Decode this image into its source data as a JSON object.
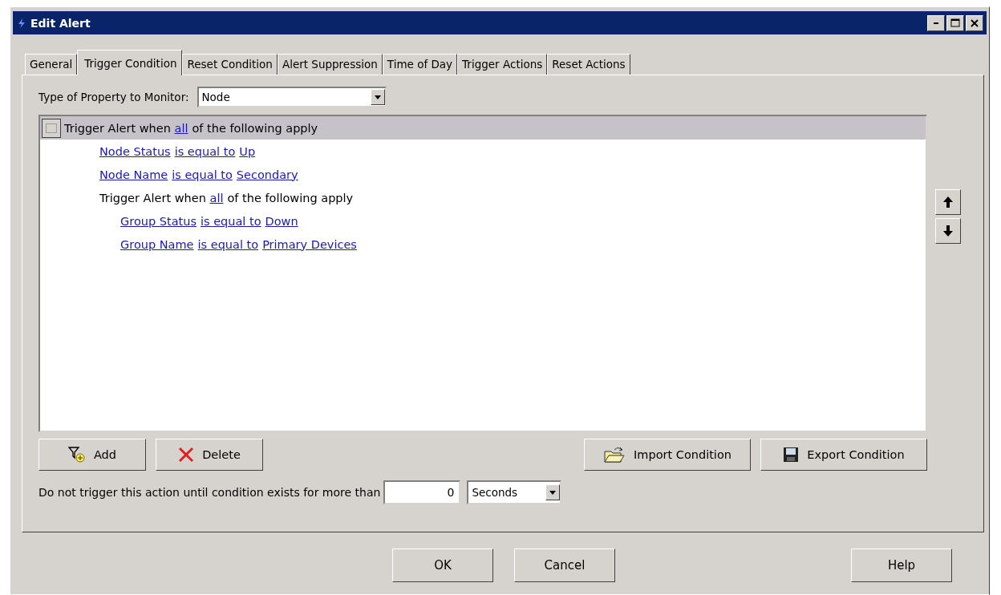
{
  "window": {
    "title": "Edit Alert"
  },
  "tabs": [
    {
      "label": "General",
      "selected": false
    },
    {
      "label": "Trigger Condition",
      "selected": true
    },
    {
      "label": "Reset Condition",
      "selected": false
    },
    {
      "label": "Alert Suppression",
      "selected": false
    },
    {
      "label": "Time of Day",
      "selected": false
    },
    {
      "label": "Trigger Actions",
      "selected": false
    },
    {
      "label": "Reset Actions",
      "selected": false
    }
  ],
  "property_type": {
    "label": "Type of Property to Monitor:",
    "value": "Node"
  },
  "condition_tree": [
    {
      "kind": "group",
      "prefix": "Trigger Alert when",
      "quantifier": "all",
      "suffix": "of the following apply",
      "selected": true,
      "children": [
        {
          "kind": "condition",
          "field": "Node Status",
          "operator": "is equal to",
          "value": "Up",
          "selected": false
        },
        {
          "kind": "condition",
          "field": "Node Name",
          "operator": "is equal to",
          "value": "Secondary",
          "selected": false
        },
        {
          "kind": "group",
          "prefix": "Trigger Alert when",
          "quantifier": "all",
          "suffix": "of the following apply",
          "selected": false,
          "children": [
            {
              "kind": "condition",
              "field": "Group Status",
              "operator": "is equal to",
              "value": "Down",
              "selected": false
            },
            {
              "kind": "condition",
              "field": "Group Name",
              "operator": "is equal to",
              "value": "Primary Devices",
              "selected": false
            }
          ]
        }
      ]
    }
  ],
  "condition_buttons": [
    {
      "kind": "add",
      "label": "Add"
    },
    {
      "kind": "delete",
      "label": "Delete"
    },
    {
      "kind": "import",
      "label": "Import Condition"
    },
    {
      "kind": "export",
      "label": "Export Condition"
    }
  ],
  "delay": {
    "label": "Do not trigger this action until condition exists for more than",
    "value": "0",
    "unit": "Seconds"
  },
  "dialog_buttons": [
    "OK",
    "Cancel",
    "Help"
  ]
}
